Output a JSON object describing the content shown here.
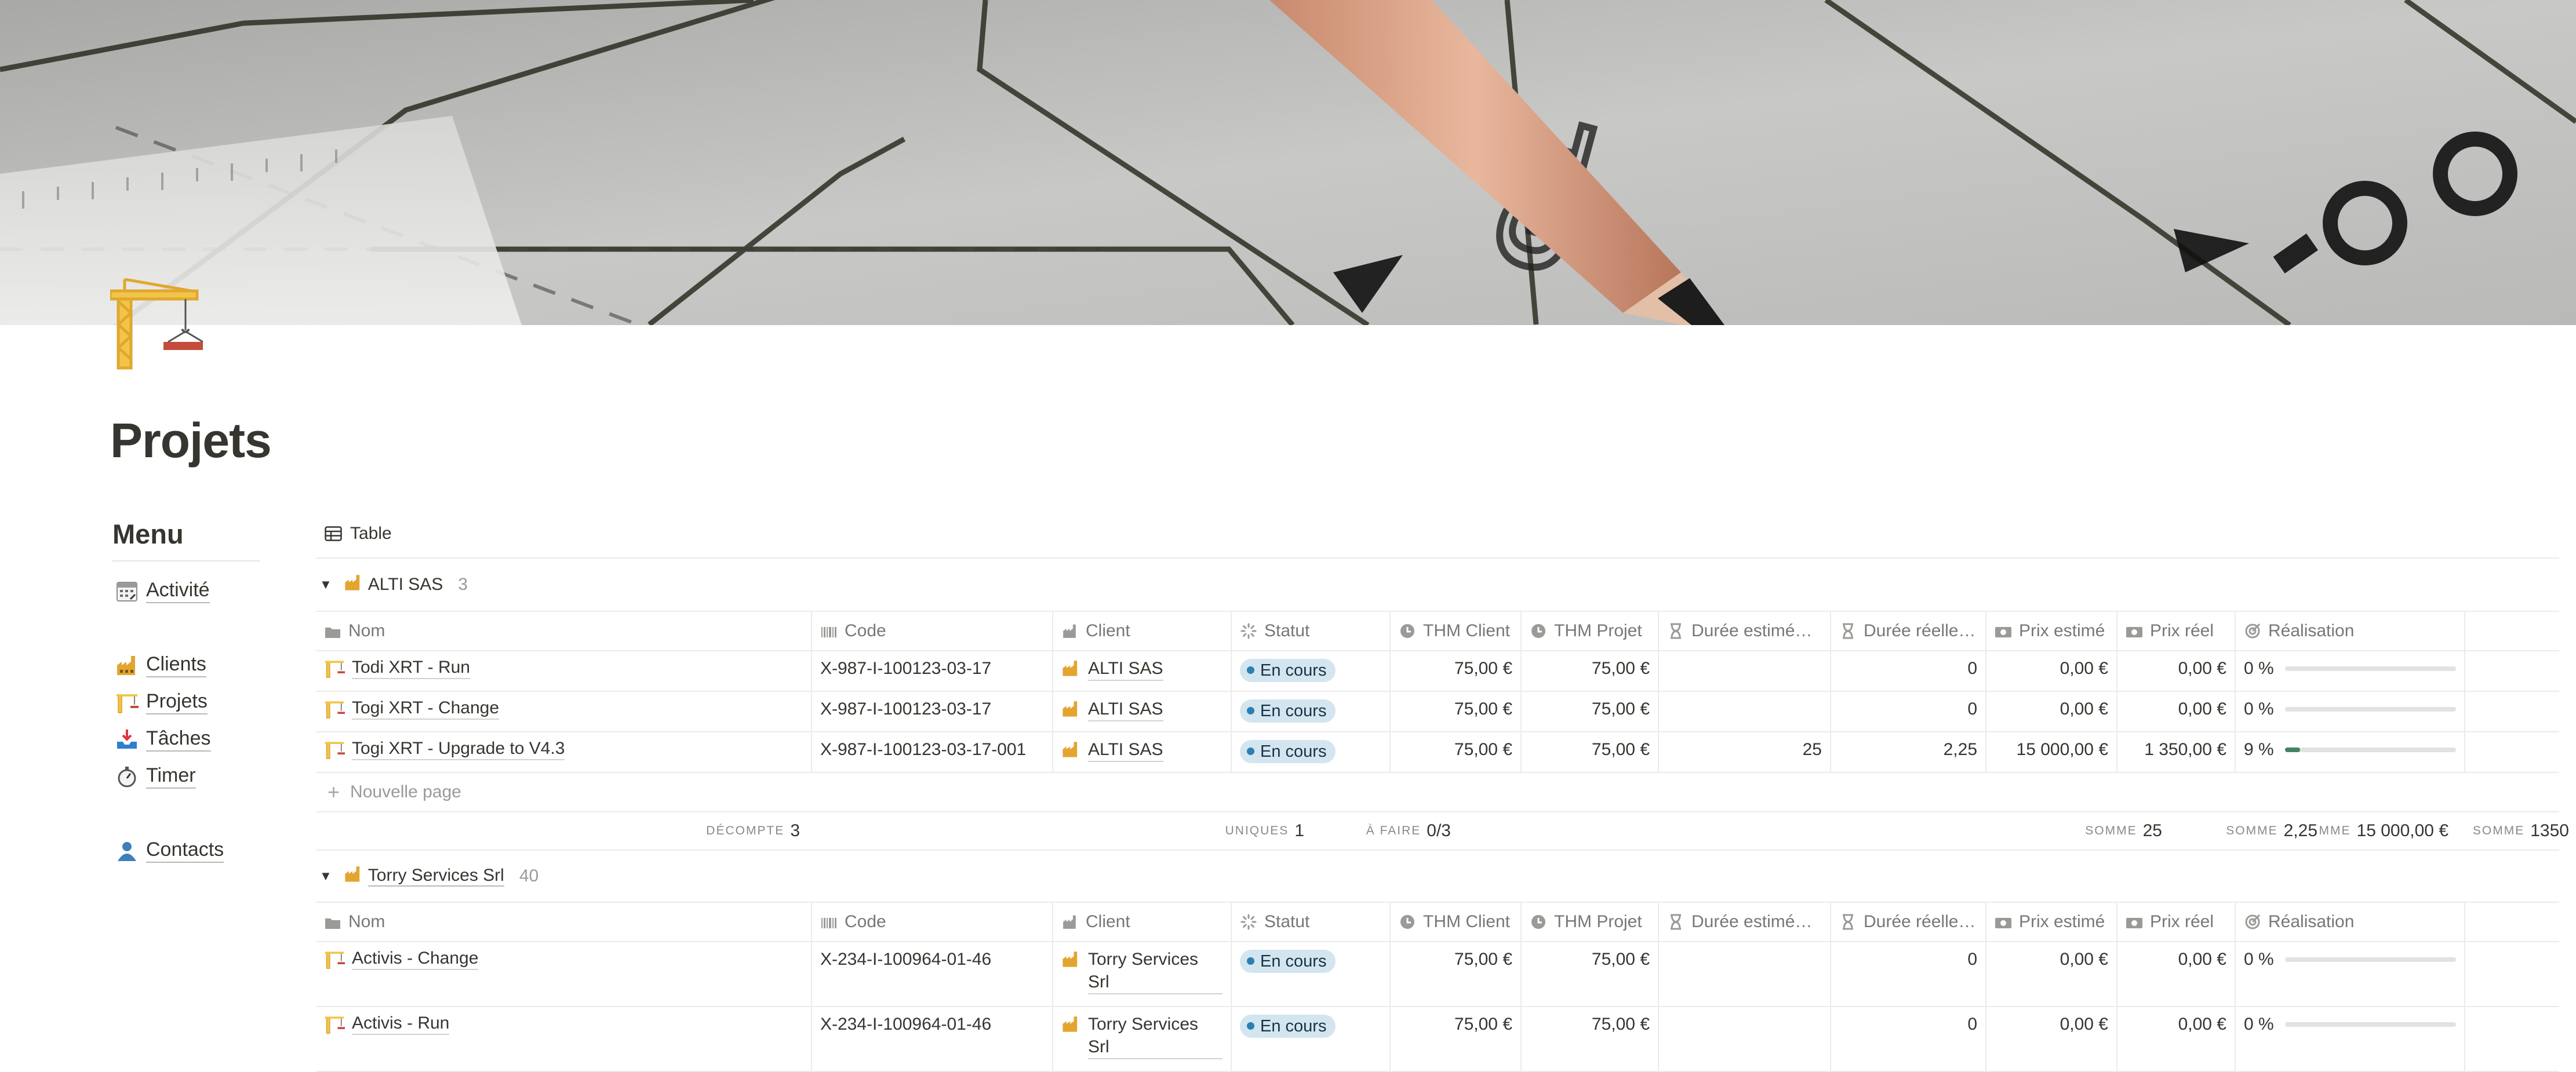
{
  "page": {
    "title": "Projets",
    "icon": "construction-crane-icon"
  },
  "menu": {
    "title": "Menu",
    "items": [
      {
        "label": "Activité",
        "icon": "calendar-icon"
      },
      {
        "label": "Clients",
        "icon": "factory-icon"
      },
      {
        "label": "Projets",
        "icon": "construction-crane-icon"
      },
      {
        "label": "Tâches",
        "icon": "inbox-tray-icon"
      },
      {
        "label": "Timer",
        "icon": "stopwatch-icon"
      },
      {
        "label": "Contacts",
        "icon": "person-icon"
      }
    ]
  },
  "view": {
    "label": "Table"
  },
  "columns": [
    "Nom",
    "Code",
    "Client",
    "Statut",
    "THM Client",
    "THM Projet",
    "Durée estimée ...",
    "Durée réelle ...",
    "Prix estimé",
    "Prix réel",
    "Réalisation"
  ],
  "status_color": "#d3e5ef",
  "progress_color": "#448361",
  "groups": [
    {
      "name": "ALTI SAS",
      "count": "3",
      "rows": [
        {
          "nom": "Todi XRT - Run",
          "code": "X-987-I-100123-03-17",
          "client": "ALTI SAS",
          "statut": "En cours",
          "thm_client": "75,00 €",
          "thm_projet": "75,00 €",
          "duree_estimee": "",
          "duree_reelle": "0",
          "prix_estime": "0,00 €",
          "prix_reel": "0,00 €",
          "realisation": "0 %",
          "progress": 0
        },
        {
          "nom": "Togi XRT - Change",
          "code": "X-987-I-100123-03-17",
          "client": "ALTI SAS",
          "statut": "En cours",
          "thm_client": "75,00 €",
          "thm_projet": "75,00 €",
          "duree_estimee": "",
          "duree_reelle": "0",
          "prix_estime": "0,00 €",
          "prix_reel": "0,00 €",
          "realisation": "0 %",
          "progress": 0
        },
        {
          "nom": "Togi XRT - Upgrade to V4.3",
          "code": "X-987-I-100123-03-17-001",
          "client": "ALTI SAS",
          "statut": "En cours",
          "thm_client": "75,00 €",
          "thm_projet": "75,00 €",
          "duree_estimee": "25",
          "duree_reelle": "2,25",
          "prix_estime": "15 000,00 €",
          "prix_reel": "1 350,00 €",
          "realisation": "9 %",
          "progress": 0.09
        }
      ],
      "new_page": "Nouvelle page",
      "calc": {
        "count_label": "DÉCOMPTE",
        "count_value": "3",
        "unique_label": "UNIQUES",
        "unique_value": "1",
        "todo_label": "À FAIRE",
        "todo_value": "0/3",
        "sum1_label": "SOMME",
        "sum1_value": "25",
        "sum2_label": "SOMME",
        "sum2_value": "2,25",
        "sum3_label": "MME",
        "sum3_value": "15 000,00 €",
        "sum4_label": "SOMME",
        "sum4_value": "1350"
      }
    },
    {
      "name": "Torry Services Srl",
      "count": "40",
      "rows": [
        {
          "nom": "Activis - Change",
          "code": "X-234-I-100964-01-46",
          "client": "Torry Services Srl",
          "statut": "En cours",
          "thm_client": "75,00 €",
          "thm_projet": "75,00 €",
          "duree_estimee": "",
          "duree_reelle": "0",
          "prix_estime": "0,00 €",
          "prix_reel": "0,00 €",
          "realisation": "0 %",
          "progress": 0
        },
        {
          "nom": "Activis - Run",
          "code": "X-234-I-100964-01-46",
          "client": "Torry Services Srl",
          "statut": "En cours",
          "thm_client": "75,00 €",
          "thm_projet": "75,00 €",
          "duree_estimee": "",
          "duree_reelle": "0",
          "prix_estime": "0,00 €",
          "prix_reel": "0,00 €",
          "realisation": "0 %",
          "progress": 0
        }
      ]
    }
  ]
}
